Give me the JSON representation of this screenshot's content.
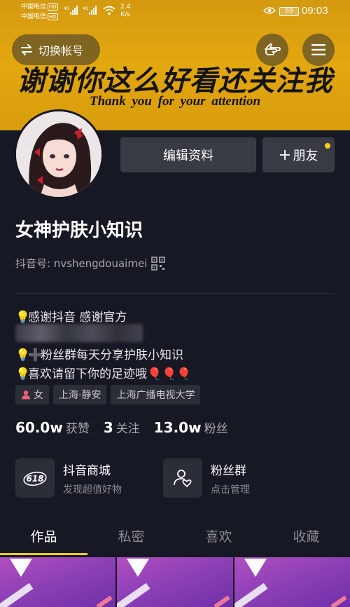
{
  "status_bar": {
    "carrier1": "中国电信",
    "carrier2": "中国电信",
    "hd_badge": "HD",
    "net1": "4G",
    "net2": "4G",
    "speed_value": "2.4",
    "speed_unit": "K/s",
    "battery": "69",
    "time": "09:03"
  },
  "banner": {
    "switch_label": "切换帐号",
    "title": "谢谢你这么好看还关注我",
    "subtitle": "Thank you for your attention",
    "gesture_icon": "pointing-hand-icon",
    "menu_icon": "hamburger-menu-icon"
  },
  "profile": {
    "edit_label": "编辑资料",
    "friend_label": "朋友",
    "nickname": "女神护肤小知识",
    "id_label": "抖音号: nvshengdouaimei",
    "accent": "#face15"
  },
  "bio": {
    "line1": "感谢抖音 感谢官方",
    "line3": "粉丝群每天分享护肤小知识",
    "line4": "喜欢请留下你的足迹哦",
    "balloons": "🎈🎈🎈"
  },
  "tags": [
    {
      "label": "女"
    },
    {
      "label": "上海·静安"
    },
    {
      "label": "上海广播电视大学"
    }
  ],
  "stats": [
    {
      "value": "60.0w",
      "label": "获赞"
    },
    {
      "value": "3",
      "label": "关注"
    },
    {
      "value": "13.0w",
      "label": "粉丝"
    }
  ],
  "features": [
    {
      "title": "抖音商城",
      "subtitle": "发现超值好物",
      "icon_text": "618"
    },
    {
      "title": "粉丝群",
      "subtitle": "点击管理"
    }
  ],
  "tabs": [
    {
      "label": "作品"
    },
    {
      "label": "私密"
    },
    {
      "label": "喜欢"
    },
    {
      "label": "收藏"
    }
  ]
}
